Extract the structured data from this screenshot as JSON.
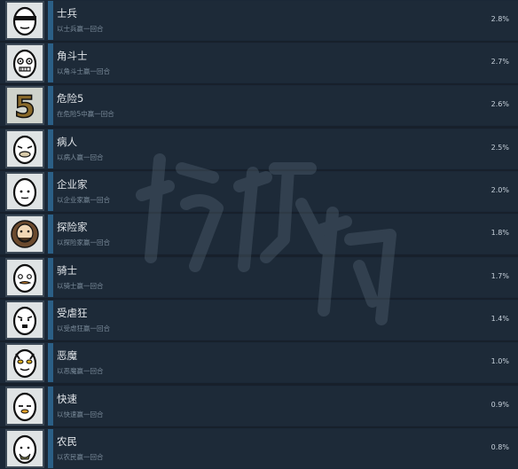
{
  "colors": {
    "background": "#17202b",
    "row": "#1d2a38",
    "progress_bar": "#2b5f86",
    "title_text": "#e2e6ea",
    "description_text": "#7a8b9a",
    "percent_text": "#c8d2dc"
  },
  "achievements": [
    {
      "name": "士兵",
      "description": "以士兵赢一回合",
      "percent": "2.8%",
      "icon": "egg-sunglasses-icon"
    },
    {
      "name": "角斗士",
      "description": "以角斗士赢一回合",
      "percent": "2.7%",
      "icon": "egg-gladiator-icon"
    },
    {
      "name": "危险5",
      "description": "在危险5中赢一回合",
      "percent": "2.6%",
      "icon": "number-five-icon"
    },
    {
      "name": "病人",
      "description": "以病人赢一回合",
      "percent": "2.5%",
      "icon": "egg-sick-icon"
    },
    {
      "name": "企业家",
      "description": "以企业家赢一回合",
      "percent": "2.0%",
      "icon": "egg-entrepreneur-icon"
    },
    {
      "name": "探险家",
      "description": "以探险家赢一回合",
      "percent": "1.8%",
      "icon": "egg-explorer-icon"
    },
    {
      "name": "骑士",
      "description": "以骑士赢一回合",
      "percent": "1.7%",
      "icon": "egg-knight-icon"
    },
    {
      "name": "受虐狂",
      "description": "以受虐狂赢一回合",
      "percent": "1.4%",
      "icon": "egg-masochist-icon"
    },
    {
      "name": "恶魔",
      "description": "以恶魔赢一回合",
      "percent": "1.0%",
      "icon": "egg-demon-icon"
    },
    {
      "name": "快速",
      "description": "以快速赢一回合",
      "percent": "0.9%",
      "icon": "egg-speedy-icon"
    },
    {
      "name": "农民",
      "description": "以农民赢一回合",
      "percent": "0.8%",
      "icon": "egg-farmer-icon"
    }
  ]
}
